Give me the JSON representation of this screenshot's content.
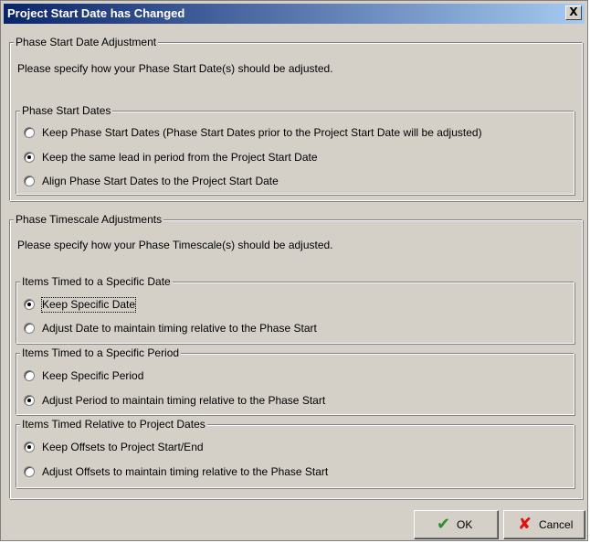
{
  "dialog": {
    "title": "Project Start Date has Changed",
    "close_glyph": "X"
  },
  "phase_start": {
    "legend": "Phase Start Date Adjustment",
    "description": "Please specify how your Phase Start Date(s) should be adjusted.",
    "dates_group": {
      "legend": "Phase Start Dates",
      "options": [
        {
          "label": "Keep Phase Start Dates (Phase Start Dates prior to the Project Start Date will be adjusted)",
          "selected": false
        },
        {
          "label": "Keep the same lead in period from the Project Start Date",
          "selected": true
        },
        {
          "label": "Align Phase Start Dates to the Project Start Date",
          "selected": false
        }
      ]
    }
  },
  "timescale": {
    "legend": "Phase Timescale Adjustments",
    "description": "Please specify how your Phase Timescale(s) should be adjusted.",
    "specific_date": {
      "legend": "Items Timed to a Specific Date",
      "options": [
        {
          "label": "Keep Specific Date",
          "selected": true
        },
        {
          "label": "Adjust Date to maintain timing relative to the Phase Start",
          "selected": false
        }
      ]
    },
    "specific_period": {
      "legend": "Items Timed to a Specific Period",
      "options": [
        {
          "label": "Keep Specific Period",
          "selected": false
        },
        {
          "label": "Adjust Period to maintain timing relative to the Phase Start",
          "selected": true
        }
      ]
    },
    "project_dates": {
      "legend": "Items Timed Relative to Project Dates",
      "options": [
        {
          "label": "Keep Offsets to Project Start/End",
          "selected": true
        },
        {
          "label": "Adjust Offsets to maintain timing relative to the Phase Start",
          "selected": false
        }
      ]
    }
  },
  "buttons": {
    "ok": {
      "label": "OK",
      "icon": "check-icon",
      "color": "#2e8b2e"
    },
    "cancel": {
      "label": "Cancel",
      "icon": "x-icon",
      "color": "#e01010"
    }
  }
}
